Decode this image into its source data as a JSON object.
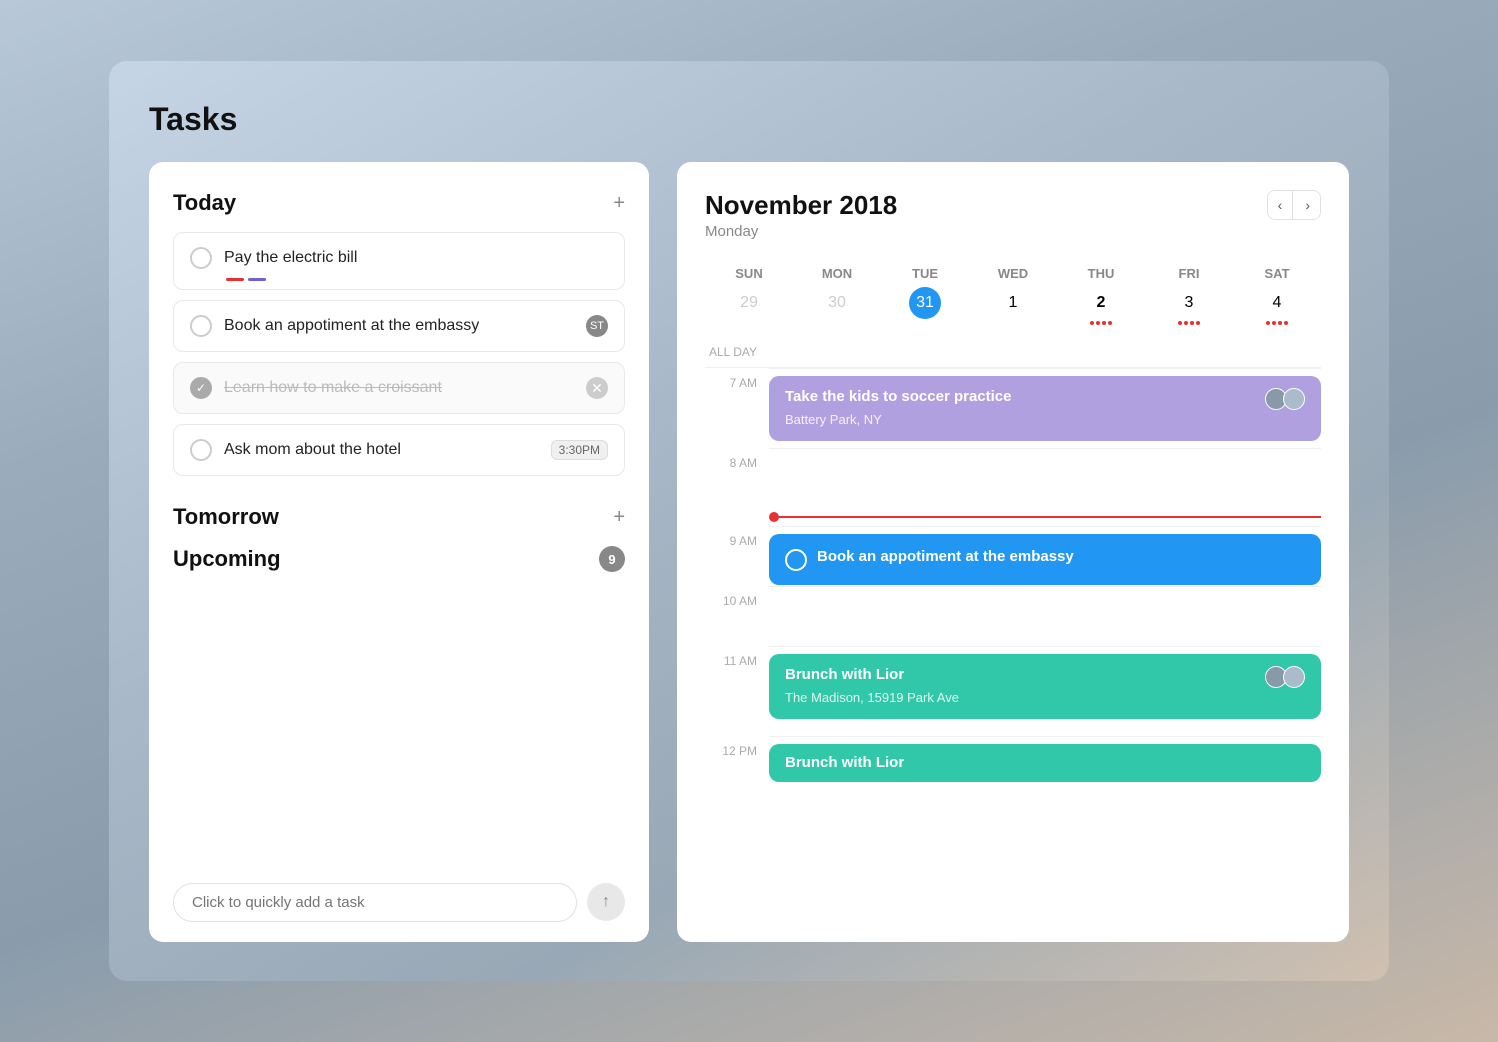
{
  "app": {
    "title": "Tasks"
  },
  "left_panel": {
    "today_section": {
      "title": "Today",
      "add_label": "+"
    },
    "tasks": [
      {
        "id": "task-1",
        "text": "Pay the electric bill",
        "completed": false,
        "has_priority": true,
        "badge": null,
        "time": null
      },
      {
        "id": "task-2",
        "text": "Book an appotiment at the embassy",
        "completed": false,
        "has_priority": false,
        "badge": "ST",
        "time": null
      },
      {
        "id": "task-3",
        "text": "Learn how to make a croissant",
        "completed": true,
        "has_priority": false,
        "badge": null,
        "time": null
      },
      {
        "id": "task-4",
        "text": "Ask mom about the hotel",
        "completed": false,
        "has_priority": false,
        "badge": null,
        "time": "3:30PM"
      }
    ],
    "tomorrow_section": {
      "title": "Tomorrow",
      "add_label": "+"
    },
    "upcoming_section": {
      "title": "Upcoming",
      "badge": "9"
    },
    "quick_add": {
      "placeholder": "Click to quickly add a task",
      "submit_icon": "↑"
    }
  },
  "right_panel": {
    "month": "November 2018",
    "day_of_week": "Monday",
    "nav_prev": "‹",
    "nav_next": "›",
    "day_headers": [
      "SUN",
      "MON",
      "TUE",
      "WED",
      "THU",
      "FRI",
      "SAT"
    ],
    "weeks": [
      [
        {
          "num": "29",
          "muted": true,
          "today": false,
          "dots": []
        },
        {
          "num": "30",
          "muted": true,
          "today": false,
          "dots": []
        },
        {
          "num": "31",
          "muted": false,
          "today": true,
          "dots": []
        },
        {
          "num": "1",
          "muted": false,
          "today": false,
          "dots": []
        },
        {
          "num": "2",
          "muted": false,
          "today": false,
          "bold": true,
          "dots": [
            "red",
            "red",
            "red",
            "red"
          ]
        },
        {
          "num": "3",
          "muted": false,
          "today": false,
          "dots": [
            "red",
            "red",
            "red",
            "red"
          ]
        },
        {
          "num": "4",
          "muted": false,
          "today": false,
          "dots": [
            "red",
            "red",
            "red",
            "red"
          ]
        }
      ]
    ],
    "timeline": {
      "all_day_label": "ALL DAY",
      "events": [
        {
          "time": "7 AM",
          "type": "purple",
          "title": "Take the kids to soccer practice",
          "location": "Battery Park, NY",
          "has_avatars": true,
          "spans": 1.5
        },
        {
          "time": "8 AM",
          "type": "empty"
        },
        {
          "time": "9 AM",
          "type": "blue",
          "title": "Book an appotiment at the embassy",
          "has_circle": true
        },
        {
          "time": "10 AM",
          "type": "empty"
        },
        {
          "time": "11 AM",
          "type": "teal",
          "title": "Brunch with Lior",
          "location": "The Madison, 15919 Park Ave",
          "has_avatars": true
        },
        {
          "time": "12 PM",
          "type": "teal",
          "title": "Brunch with Lior"
        }
      ]
    }
  }
}
